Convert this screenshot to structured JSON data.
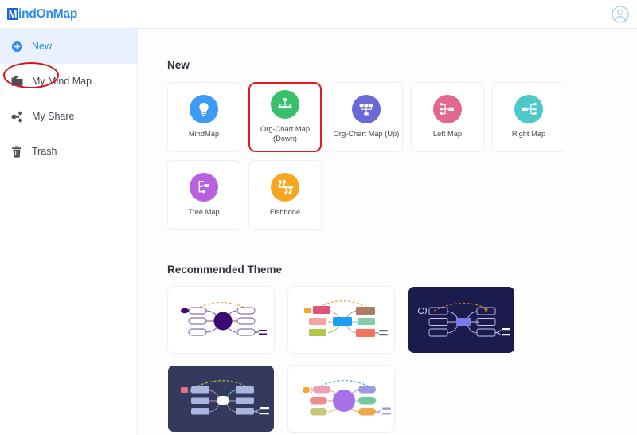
{
  "header": {
    "logo_text": "indOnMap",
    "logo_badge": "M",
    "avatar_icon": "user-avatar-icon"
  },
  "sidebar": {
    "items": [
      {
        "label": "New",
        "icon": "plus-circle-icon",
        "active": true
      },
      {
        "label": "My Mind Map",
        "icon": "folder-icon",
        "active": false
      },
      {
        "label": "My Share",
        "icon": "share-icon",
        "active": false
      },
      {
        "label": "Trash",
        "icon": "trash-icon",
        "active": false
      }
    ]
  },
  "main": {
    "new_section_title": "New",
    "theme_section_title": "Recommended Theme",
    "templates": [
      {
        "label": "MindMap",
        "icon": "lightbulb-icon",
        "color": "#3d9bf3",
        "selected": false
      },
      {
        "label": "Org-Chart Map (Down)",
        "icon": "org-chart-down-icon",
        "color": "#39c06d",
        "selected": true
      },
      {
        "label": "Org-Chart Map (Up)",
        "icon": "org-chart-up-icon",
        "color": "#6a6ad6",
        "selected": false
      },
      {
        "label": "Left Map",
        "icon": "left-map-icon",
        "color": "#e2688f",
        "selected": false
      },
      {
        "label": "Right Map",
        "icon": "right-map-icon",
        "color": "#4ec8c8",
        "selected": false
      },
      {
        "label": "Tree Map",
        "icon": "tree-map-icon",
        "color": "#b861de",
        "selected": false
      },
      {
        "label": "Fishbone",
        "icon": "fishbone-icon",
        "color": "#f5a623",
        "selected": false
      }
    ],
    "themes": [
      {
        "name": "theme-violet-light",
        "bg": "#ffffff",
        "center": "#3b0a70",
        "node_stroke": "#6b4fa0",
        "arc": "#f0a24a",
        "dark": false
      },
      {
        "name": "theme-colorful-light",
        "bg": "#ffffff",
        "center": "#1a9ff0",
        "node_stroke": "#e9eef3",
        "arc": "#f0a24a",
        "dark": false
      },
      {
        "name": "theme-navy-dark",
        "bg": "#1b1b4e",
        "center": "#7b78e8",
        "node_stroke": "#c7c9ea",
        "arc": "#b97a22",
        "dark": true
      },
      {
        "name": "theme-slate-dark",
        "bg": "#343a5e",
        "center": "#ffffff",
        "node_stroke": "#b9bde0",
        "arc": "#c2b83c",
        "dark": true
      },
      {
        "name": "theme-pastel-purple",
        "bg": "#ffffff",
        "center": "#a970e8",
        "node_stroke": "#e9eef3",
        "arc": "#49a5d8",
        "dark": false
      }
    ]
  },
  "annotations": {
    "new_highlight": "red-ellipse",
    "selected_card_highlight": "red-rounded-box"
  }
}
